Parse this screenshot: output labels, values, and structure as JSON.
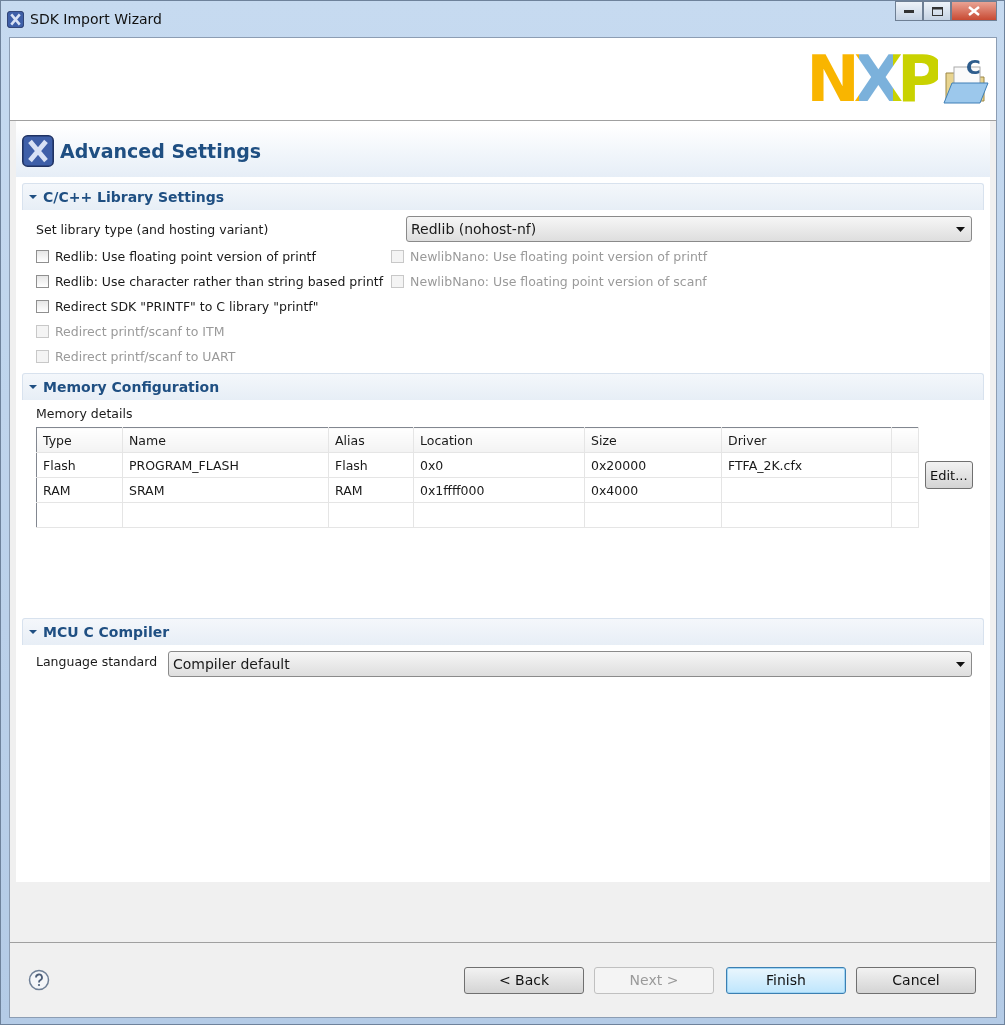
{
  "window": {
    "title": "SDK Import Wizard"
  },
  "banner": {
    "logo": "NXP",
    "badge": "C"
  },
  "page": {
    "title": "Advanced Settings"
  },
  "library": {
    "heading": "C/C++ Library Settings",
    "expanded": true,
    "type_label": "Set library type (and hosting variant)",
    "type_value": "Redlib (nohost-nf)",
    "left_options": [
      {
        "label": "Redlib: Use floating point version of printf",
        "checked": false,
        "disabled": false
      },
      {
        "label": "Redlib: Use character rather than string based printf",
        "checked": false,
        "disabled": false
      },
      {
        "label": "Redirect SDK \"PRINTF\" to C library \"printf\"",
        "checked": false,
        "disabled": false
      },
      {
        "label": "Redirect printf/scanf to ITM",
        "checked": false,
        "disabled": true
      },
      {
        "label": "Redirect printf/scanf to UART",
        "checked": false,
        "disabled": true
      }
    ],
    "right_options": [
      {
        "label": "NewlibNano: Use floating point version of printf",
        "checked": false,
        "disabled": true
      },
      {
        "label": "NewlibNano: Use floating point version of scanf",
        "checked": false,
        "disabled": true
      }
    ]
  },
  "memory": {
    "heading": "Memory Configuration",
    "expanded": true,
    "label": "Memory details",
    "columns": [
      "Type",
      "Name",
      "Alias",
      "Location",
      "Size",
      "Driver"
    ],
    "rows": [
      [
        "Flash",
        "PROGRAM_FLASH",
        "Flash",
        "0x0",
        "0x20000",
        "FTFA_2K.cfx"
      ],
      [
        "RAM",
        "SRAM",
        "RAM",
        "0x1ffff000",
        "0x4000",
        ""
      ]
    ],
    "edit_button": "Edit..."
  },
  "compiler": {
    "heading": "MCU C Compiler",
    "expanded": true,
    "label": "Language standard",
    "value": "Compiler default"
  },
  "buttons": [
    {
      "label": "< Back",
      "disabled": false,
      "default": false
    },
    {
      "label": "Next >",
      "disabled": true,
      "default": false
    },
    {
      "label": "Finish",
      "disabled": false,
      "default": true
    },
    {
      "label": "Cancel",
      "disabled": false,
      "default": false
    }
  ]
}
